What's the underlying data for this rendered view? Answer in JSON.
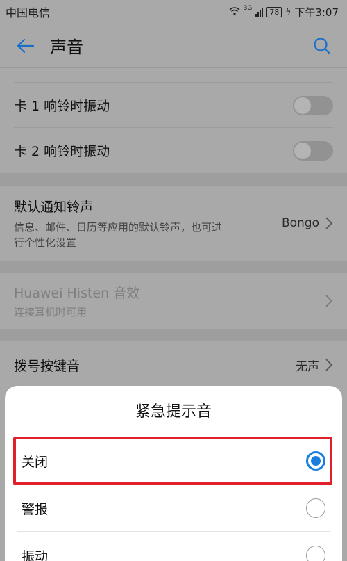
{
  "status_bar": {
    "carrier": "中国电信",
    "network": "3G",
    "battery": "78",
    "time": "下午3:07"
  },
  "header": {
    "title": "声音"
  },
  "settings": {
    "ring_vibrate_sim1": {
      "label": "卡 1 响铃时振动",
      "enabled": false
    },
    "ring_vibrate_sim2": {
      "label": "卡 2 响铃时振动",
      "enabled": false
    },
    "default_notification": {
      "title": "默认通知铃声",
      "subtitle": "信息、邮件、日历等应用的默认铃声，也可进行个性化设置",
      "value": "Bongo"
    },
    "histen": {
      "title": "Huawei Histen 音效",
      "subtitle": "连接耳机时可用"
    },
    "dial_tone": {
      "label": "拨号按键音",
      "value": "无声"
    }
  },
  "sheet": {
    "title": "紧急提示音",
    "options": [
      {
        "label": "关闭",
        "selected": true
      },
      {
        "label": "警报",
        "selected": false
      },
      {
        "label": "振动",
        "selected": false
      }
    ]
  },
  "colors": {
    "accent": "#1a7ee0",
    "highlight_box": "#e0202b",
    "dim_background": "#a9a9a9"
  }
}
